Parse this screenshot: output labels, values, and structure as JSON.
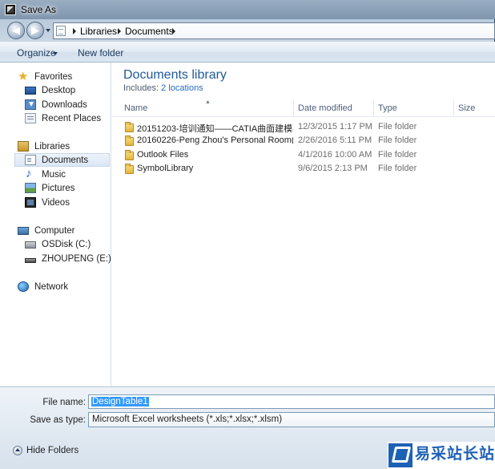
{
  "window": {
    "title": "Save As"
  },
  "address": {
    "crumbs": [
      "Libraries",
      "Documents"
    ]
  },
  "toolbar": {
    "organize_label": "Organize",
    "new_folder_label": "New folder"
  },
  "sidebar": {
    "favorites": {
      "label": "Favorites",
      "items": [
        "Desktop",
        "Downloads",
        "Recent Places"
      ]
    },
    "libraries": {
      "label": "Libraries",
      "items": [
        "Documents",
        "Music",
        "Pictures",
        "Videos"
      ],
      "selected": "Documents"
    },
    "computer": {
      "label": "Computer",
      "items": [
        "OSDisk (C:)",
        "ZHOUPENG (E:)"
      ]
    },
    "network": {
      "label": "Network"
    }
  },
  "library": {
    "title": "Documents library",
    "includes_label": "Includes:",
    "locations_link": "2 locations"
  },
  "columns": [
    "Name",
    "Date modified",
    "Type",
    "Size"
  ],
  "files": [
    {
      "name": "20151203-培训通知——CATIA曲面建模(4...",
      "date": "12/3/2015 1:17 PM",
      "type": "File folder"
    },
    {
      "name": "20160226-Peng Zhou's Personal Room(4...",
      "date": "2/26/2016 5:11 PM",
      "type": "File folder"
    },
    {
      "name": "Outlook Files",
      "date": "4/1/2016 10:00 AM",
      "type": "File folder"
    },
    {
      "name": "SymbolLibrary",
      "date": "9/6/2015 2:13 PM",
      "type": "File folder"
    }
  ],
  "form": {
    "file_name_label": "File name:",
    "file_name_value": "DesignTable1",
    "save_type_label": "Save as type:",
    "save_type_value": "Microsoft Excel worksheets (*.xls;*.xlsx;*.xlsm)",
    "hide_folders_label": "Hide Folders"
  },
  "watermark": {
    "text": "易采站长站"
  },
  "colors": {
    "accent_title": "#1e5a9c",
    "link": "#2a6ac0",
    "selection": "#3399ff"
  }
}
